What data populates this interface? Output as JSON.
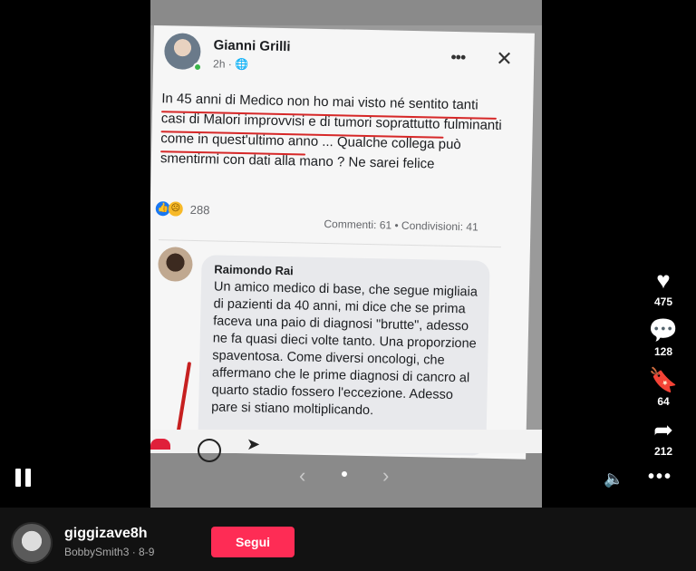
{
  "post": {
    "author": "Gianni Grilli",
    "time": "2h · 🌐",
    "more_icon": "more-horizontal-icon",
    "close_icon": "close-icon",
    "text": "In 45 anni di Medico non ho mai visto né sentito tanti casi di Malori improvvisi e di tumori soprattutto fulminanti come in quest'ultimo anno ... Qualche collega può smentirmi con dati alla mano ? Ne sarei felice",
    "reactions_count": "288",
    "stats": "Commenti: 61 • Condivisioni: 41"
  },
  "comment": {
    "author": "Raimondo Rai",
    "text": "Un amico medico di base, che segue migliaia di pazienti da 40 anni, mi dice che se prima faceva una paio di diagnosi \"brutte\", adesso ne fa quasi dieci volte tanto. Una proporzione spaventosa. Come diversi oncologi, che affermano che le prime diagnosi di cancro al quarto stadio fossero l'eccezione. Adesso pare si stiano moltiplicando."
  },
  "carousel": {
    "prev_arrow": "‹",
    "next_arrow": "›"
  },
  "actions": {
    "likes": "475",
    "comments": "128",
    "saves": "64",
    "shares": "212"
  },
  "footer": {
    "username": "giggizave8h",
    "subline": "BobbySmith3 · 8-9",
    "follow_label": "Segui"
  },
  "colors": {
    "accent": "#fe2c55",
    "annotation_red": "#d62828"
  }
}
